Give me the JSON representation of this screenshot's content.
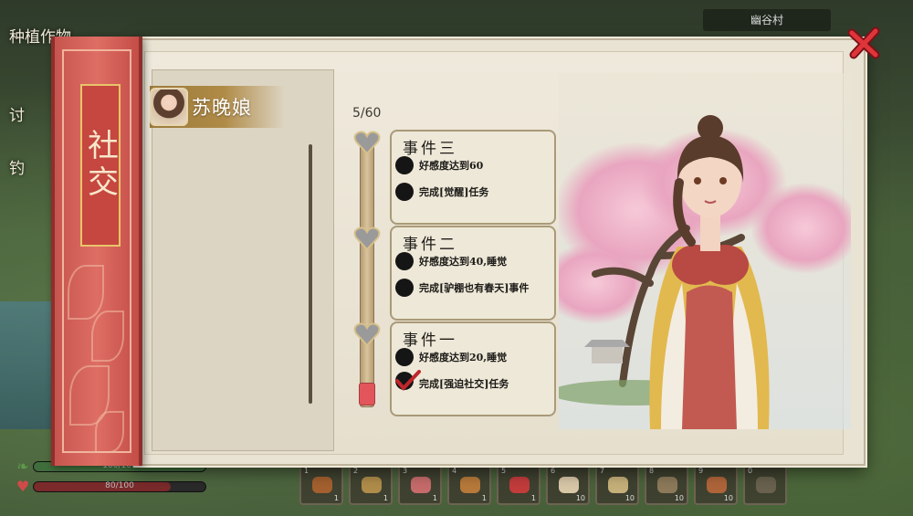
{
  "world": {
    "quests": [
      "种植作物",
      "讨",
      "钓"
    ],
    "village": "幽谷村",
    "stamina": {
      "text": "100/100",
      "fraction": 1.0
    },
    "health": {
      "text": "80/100",
      "fraction": 0.8
    }
  },
  "hotbar": [
    {
      "num": "1",
      "count": "1",
      "color": "#a5612f"
    },
    {
      "num": "2",
      "count": "1",
      "color": "#b08d4a"
    },
    {
      "num": "3",
      "count": "1",
      "color": "#c76b6b"
    },
    {
      "num": "4",
      "count": "1",
      "color": "#b87a3a"
    },
    {
      "num": "5",
      "count": "1",
      "color": "#c43c3c"
    },
    {
      "num": "6",
      "count": "10",
      "color": "#d9c8a8"
    },
    {
      "num": "7",
      "count": "10",
      "color": "#c7b17a"
    },
    {
      "num": "8",
      "count": "10",
      "color": "#8d7a5a"
    },
    {
      "num": "9",
      "count": "10",
      "color": "#b0653a"
    },
    {
      "num": "0",
      "count": "",
      "color": "#6a624f"
    }
  ],
  "dialog": {
    "title": "社交",
    "npc": {
      "name": "苏晚娘",
      "avatar_icon": "girl-portrait-icon"
    },
    "progress": {
      "text": "5/60",
      "value": 5,
      "max": 60
    },
    "events": [
      {
        "title": "事件三",
        "conditions": [
          {
            "text": "好感度达到60",
            "done": false
          },
          {
            "text": "完成[觉醒]任务",
            "done": false
          }
        ]
      },
      {
        "title": "事件二",
        "conditions": [
          {
            "text": "好感度达到40,睡觉",
            "done": false
          },
          {
            "text": "完成[驴棚也有春天]事件",
            "done": false
          }
        ]
      },
      {
        "title": "事件一",
        "conditions": [
          {
            "text": "好感度达到20,睡觉",
            "done": false
          },
          {
            "text": "完成[强迫社交]任务",
            "done": true
          }
        ]
      }
    ]
  },
  "colors": {
    "accent_red": "#d75b55",
    "gold": "#b08b47",
    "paper": "#e9e3d3",
    "check_red": "#c0262c"
  }
}
